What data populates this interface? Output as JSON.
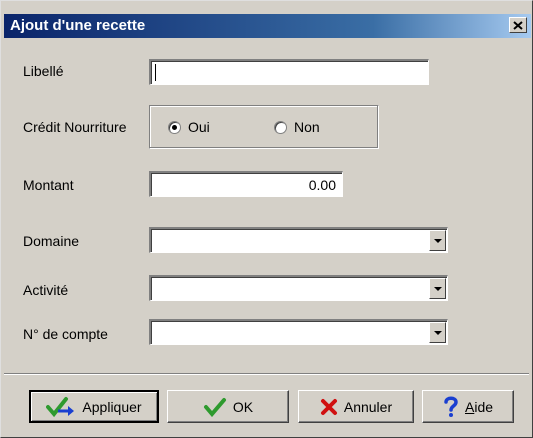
{
  "window": {
    "title": "Ajout d'une recette",
    "close_symbol": "×"
  },
  "form": {
    "libelle": {
      "label": "Libellé",
      "value": ""
    },
    "credit_nourriture": {
      "label": "Crédit Nourriture",
      "options": [
        {
          "label": "Oui",
          "selected": true
        },
        {
          "label": "Non",
          "selected": false
        }
      ]
    },
    "montant": {
      "label": "Montant",
      "value": "0.00"
    },
    "domaine": {
      "label": "Domaine",
      "value": ""
    },
    "activite": {
      "label": "Activité",
      "value": ""
    },
    "compte": {
      "label": "N° de compte",
      "value": ""
    }
  },
  "buttons": {
    "appliquer": {
      "label": "Appliquer",
      "icon": "apply-arrow-icon"
    },
    "ok": {
      "label": "OK",
      "icon": "checkmark-icon"
    },
    "annuler": {
      "label": "Annuler",
      "icon": "red-x-icon"
    },
    "aide": {
      "label_first": "A",
      "label_rest": "ide",
      "icon": "question-mark-icon"
    }
  },
  "colors": {
    "titlebar_start": "#0a246a",
    "titlebar_end": "#a6caf0",
    "dialog_bg": "#d4d0c8",
    "ok_green": "#2e9a2e",
    "cancel_red": "#d01010",
    "help_blue": "#1a3fd0"
  }
}
